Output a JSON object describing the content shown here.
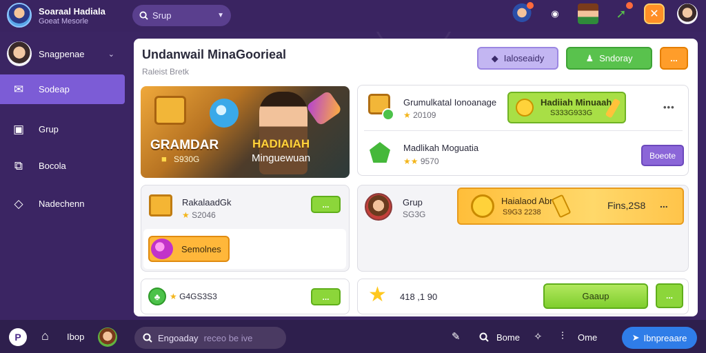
{
  "app": {
    "name": "Soaraal Hadiala",
    "subtitle": "Goeat Mesorle"
  },
  "top_search": {
    "value": "Srup"
  },
  "top_icons": [
    "character-avatar-icon",
    "record-icon",
    "pixel-character-icon",
    "rocket-icon",
    "shuffle-icon",
    "user-avatar-icon"
  ],
  "sidebar": {
    "profile_name": "Snagpenae",
    "items": [
      {
        "label": "Sodeap",
        "icon": "inbox-icon",
        "active": true
      },
      {
        "label": "Grup",
        "icon": "box-icon",
        "active": false
      },
      {
        "label": "Bocola",
        "icon": "frame-icon",
        "active": false
      },
      {
        "label": "Nadechenn",
        "icon": "diamond-icon",
        "active": false
      }
    ]
  },
  "main": {
    "title": "Undanwail MinaGoorieal",
    "subtitle": "Raleist Bretk",
    "header_buttons": {
      "lavender": "Ialoseaidy",
      "green": "Sndoray",
      "orange": "..."
    },
    "banner": {
      "left_title": "GRAMDAR",
      "left_stat": "S930G",
      "right_title": "HADIAIAH",
      "right_sub": "Minguewuan"
    },
    "cards": {
      "chest_row": {
        "title": "Grumulkatal Ionoanage",
        "stat": "20109",
        "button": "Hadiiah Minuaah",
        "button_sub": "S333G933G"
      },
      "gem_row": {
        "title": "Madlikah Moguatia",
        "stat": "9570",
        "button": "Boeote"
      },
      "box_card": {
        "title": "RakalaadGk",
        "stat": "S2046",
        "button": "...",
        "sub_button": "Semolnes"
      },
      "group_row": {
        "name": "Grup",
        "sub": "SG3G",
        "reward": "Haialaod Abn",
        "reward_sub": "S9G3 2238",
        "amount": "Fins,2S8",
        "more": "..."
      },
      "clover_row": {
        "stat": "G4GS3S3",
        "button": "..."
      },
      "star_row": {
        "stat": "418 ,1 90",
        "button": "Gaaup",
        "more": "..."
      }
    }
  },
  "bottombar": {
    "logo_letter": "P",
    "label": "Ibop",
    "search_value": "Engoaday",
    "search_placeholder": "receo be ive",
    "some_label": "Bome",
    "ome_label": "Ome",
    "cta": "Ibnpreaare"
  }
}
